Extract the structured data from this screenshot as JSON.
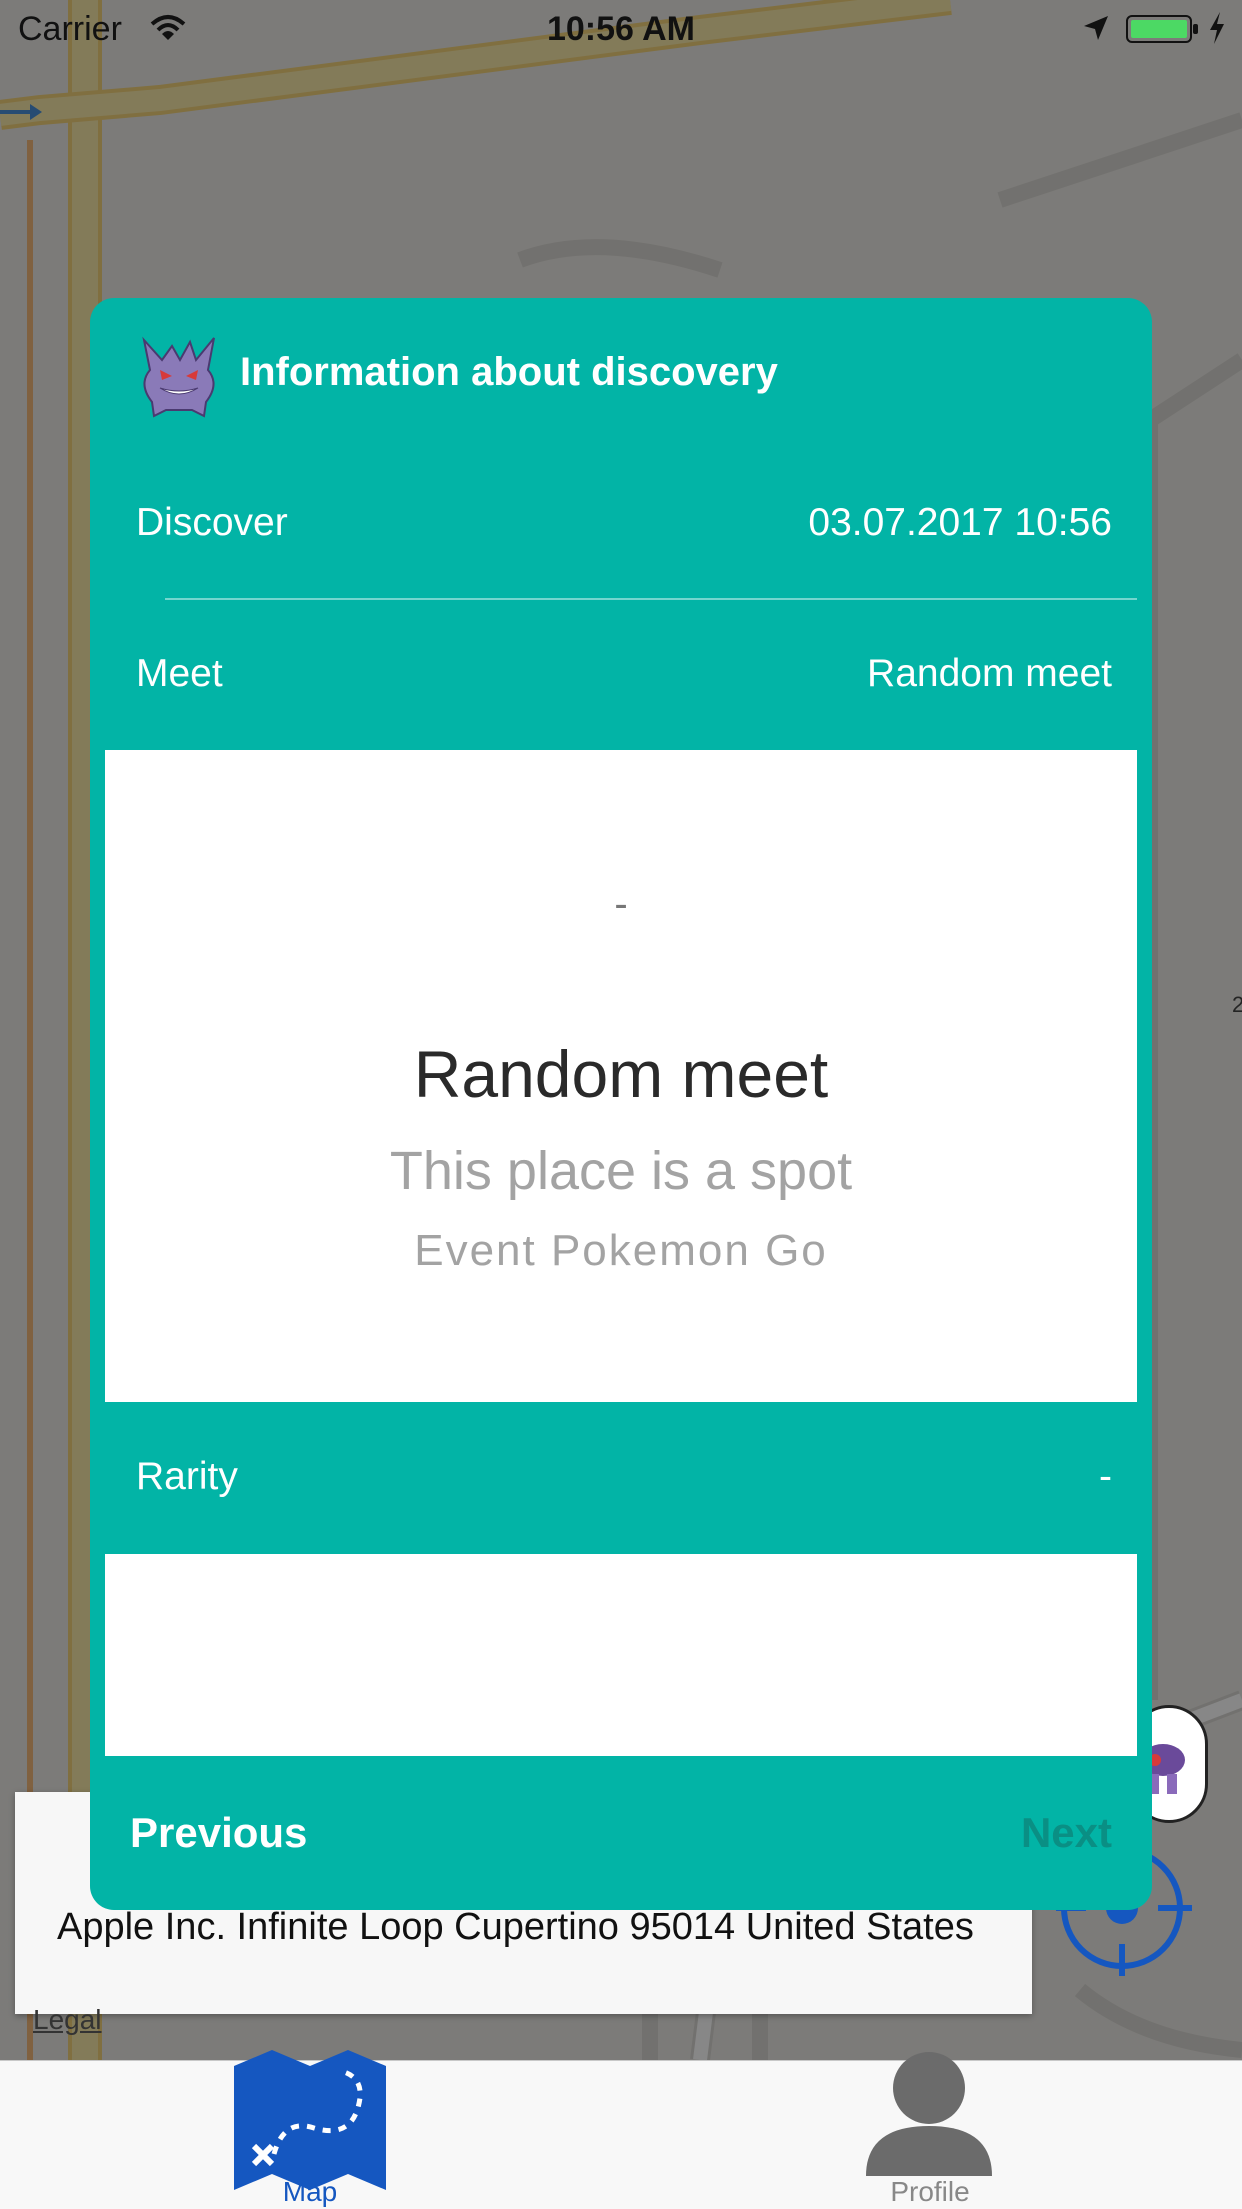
{
  "status_bar": {
    "carrier": "Carrier",
    "time": "10:56 AM"
  },
  "modal": {
    "title": "Information about discovery",
    "header_icon": "gengar-icon",
    "rows": [
      {
        "label": "Discover",
        "value": "03.07.2017 10:56"
      },
      {
        "label": "Meet",
        "value": "Random meet"
      },
      {
        "label": "Rarity",
        "value": "-"
      }
    ],
    "meet_detail": {
      "dash": "-",
      "title": "Random meet",
      "subtitle": "This place is a spot",
      "event": "Event Pokemon Go"
    },
    "footer": {
      "previous_label": "Previous",
      "next_label": "Next"
    }
  },
  "address_card": {
    "address": "Apple Inc. Infinite Loop Cupertino 95014 United States"
  },
  "map": {
    "legal_label": "Legal"
  },
  "tab_bar": {
    "tabs": [
      {
        "label": "Map",
        "icon": "treasure-map-icon",
        "active": true
      },
      {
        "label": "Profile",
        "icon": "person-icon",
        "active": false
      }
    ]
  },
  "colors": {
    "modal_background": "#02b4a6",
    "accent_blue": "#1557c0",
    "next_disabled": "#0a8f84",
    "panel_background": "#ffffff"
  }
}
